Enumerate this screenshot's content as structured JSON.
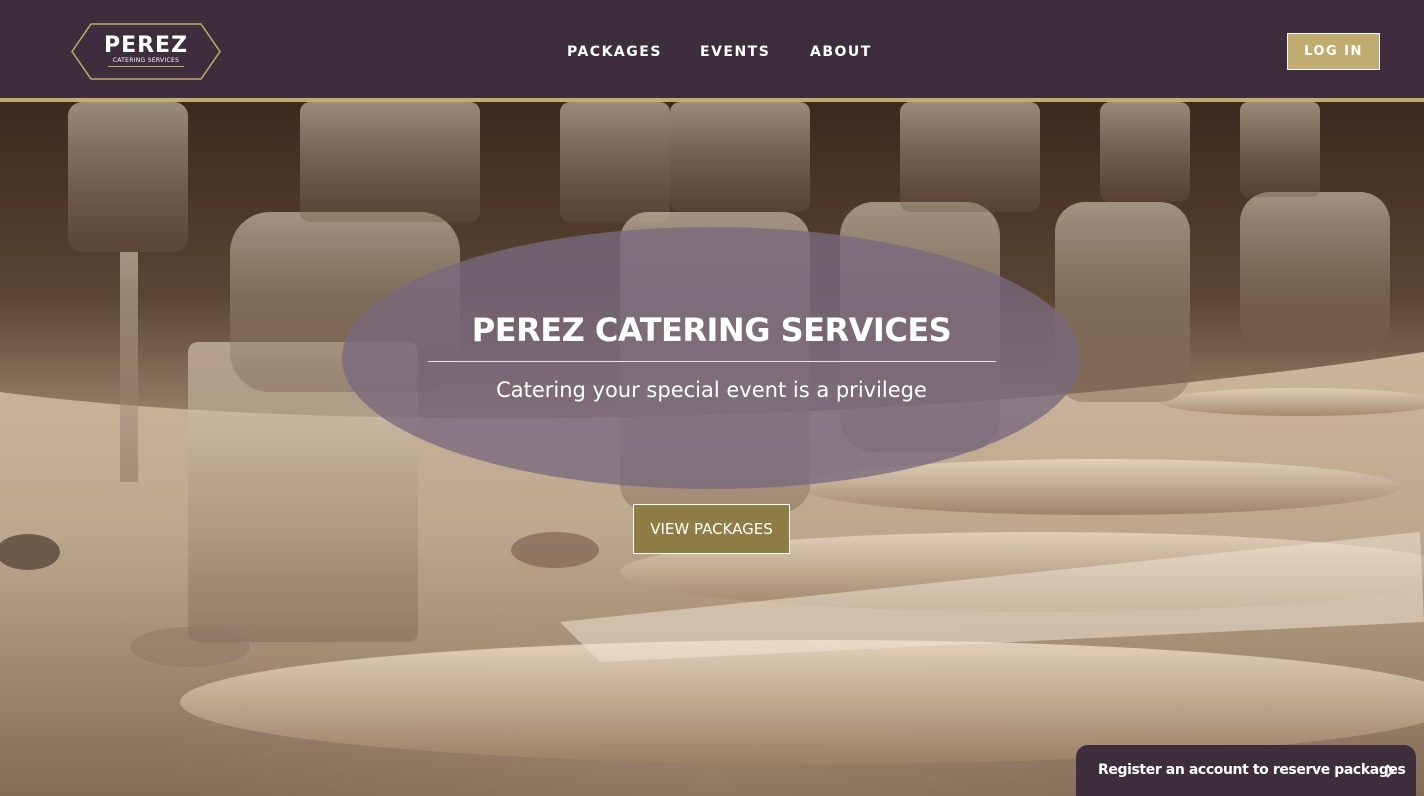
{
  "brand": {
    "name": "PEREZ",
    "tagline": "CATERING SERVICES"
  },
  "nav": {
    "items": [
      {
        "label": "PACKAGES"
      },
      {
        "label": "EVENTS"
      },
      {
        "label": "ABOUT"
      }
    ],
    "login_label": "LOG IN"
  },
  "hero": {
    "title": "PEREZ CATERING SERVICES",
    "subtitle": "Catering your special event is a privilege",
    "cta_label": "VIEW PACKAGES"
  },
  "register_banner": {
    "label": "Register an account to reserve packages",
    "icon": "chevron-right-icon"
  },
  "colors": {
    "header_bg": "#3e2e3d",
    "accent_gold": "#bfac6e",
    "cta_bg": "#8e7e45",
    "oval_overlay": "#786978"
  },
  "icons": {
    "logo": "perez-logo-hexagon",
    "register_chevron": "chevron-right-icon"
  }
}
